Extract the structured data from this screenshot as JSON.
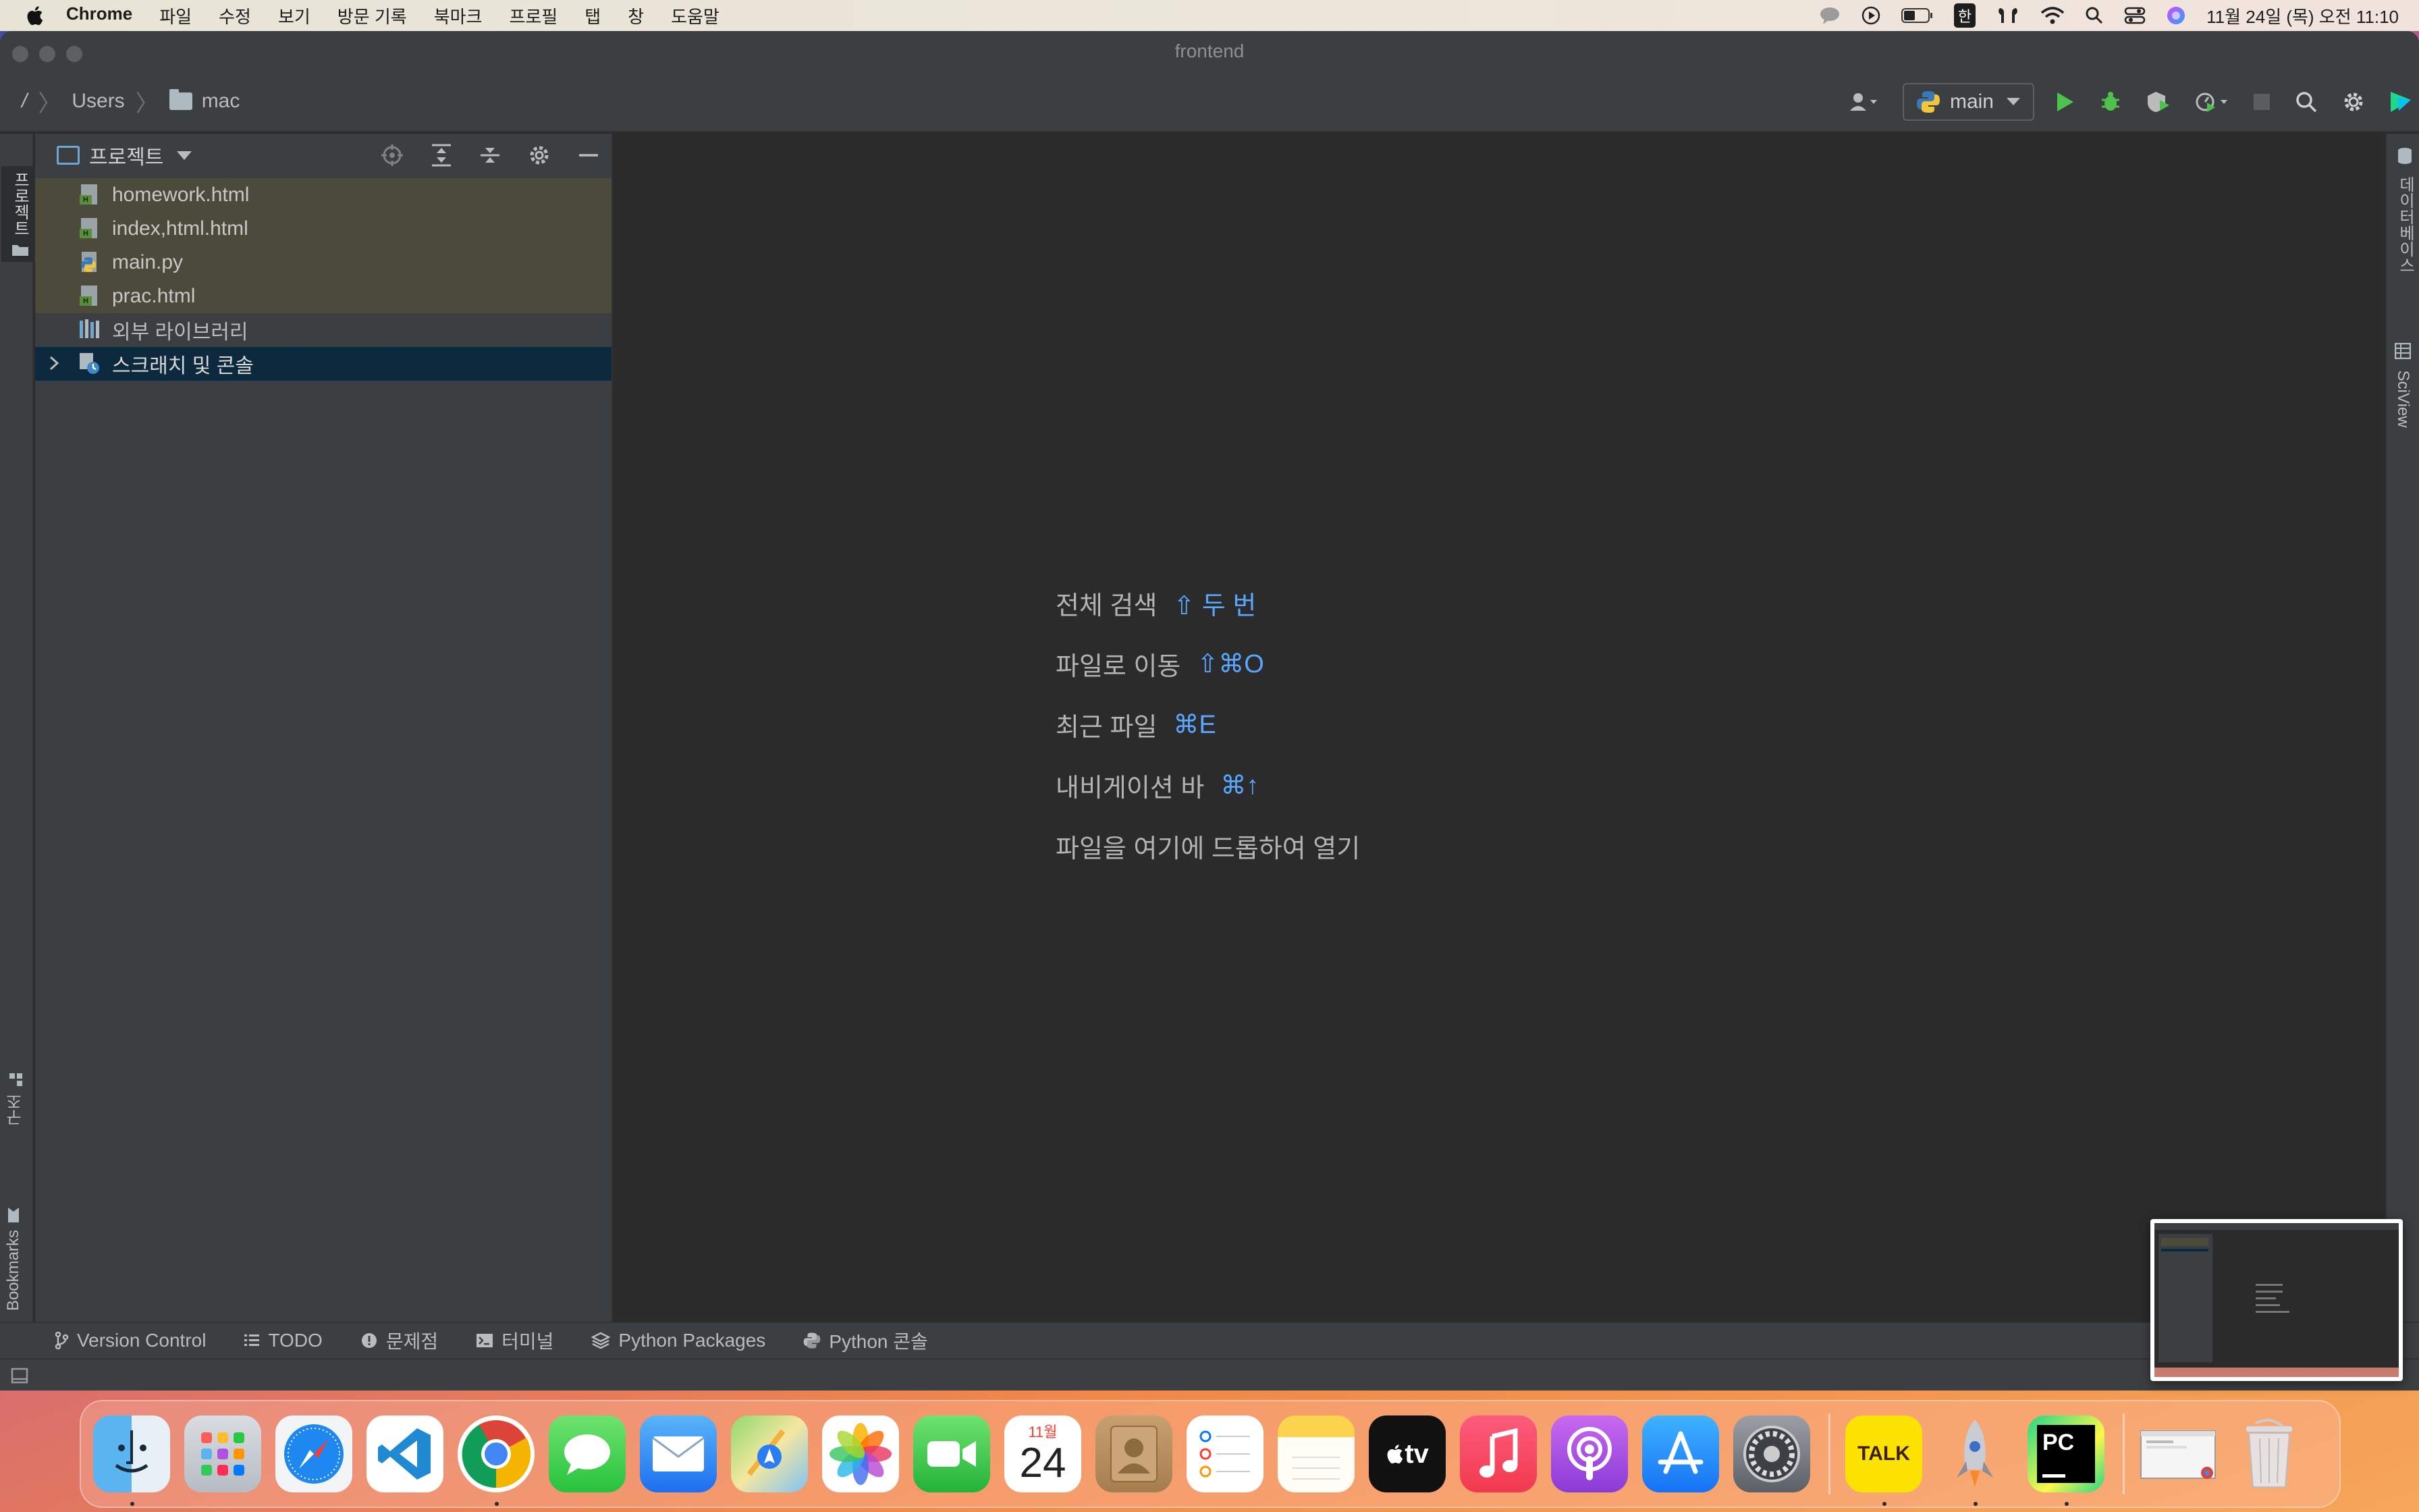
{
  "menubar": {
    "app_name": "Chrome",
    "items": [
      "파일",
      "수정",
      "보기",
      "방문 기록",
      "북마크",
      "프로필",
      "탭",
      "창",
      "도움말"
    ],
    "ime": "한",
    "clock": "11월 24일 (목) 오전 11:10"
  },
  "window": {
    "title": "frontend"
  },
  "navbar": {
    "root": "/",
    "crumbs": [
      "Users",
      "mac"
    ],
    "run_config": "main"
  },
  "left_strip": {
    "project_tab": "프로젝트",
    "structure_tab": "구조",
    "bookmarks_tab": "Bookmarks"
  },
  "right_strip": {
    "database_tab": "데이터베이스",
    "sciview_tab": "SciView"
  },
  "project_panel": {
    "title": "프로젝트",
    "files": [
      {
        "name": "homework.html",
        "type": "html"
      },
      {
        "name": "index,html.html",
        "type": "html"
      },
      {
        "name": "main.py",
        "type": "python"
      },
      {
        "name": "prac.html",
        "type": "html"
      }
    ],
    "external_libraries": "외부 라이브러리",
    "scratches": "스크래치 및 콘솔"
  },
  "editor": {
    "hints": [
      {
        "label": "전체 검색",
        "shortcut": "⇧ 두 번"
      },
      {
        "label": "파일로 이동",
        "shortcut": "⇧⌘O"
      },
      {
        "label": "최근 파일",
        "shortcut": "⌘E"
      },
      {
        "label": "내비게이션 바",
        "shortcut": "⌘↑"
      },
      {
        "label": "파일을 여기에 드롭하여 열기",
        "shortcut": ""
      }
    ]
  },
  "bottom_bar": {
    "tabs": [
      "Version Control",
      "TODO",
      "문제점",
      "터미널",
      "Python Packages",
      "Python 콘솔"
    ]
  },
  "dock": {
    "calendar_month": "11월",
    "calendar_day": "24",
    "kakao_label": "TALK",
    "pycharm_label": "PC",
    "appletv_label": "tv"
  },
  "colors": {
    "accent_blue": "#5aa6ff",
    "selection": "#0d293e",
    "file_highlight": "#4c4a3b",
    "run_green": "#4fc24d"
  }
}
